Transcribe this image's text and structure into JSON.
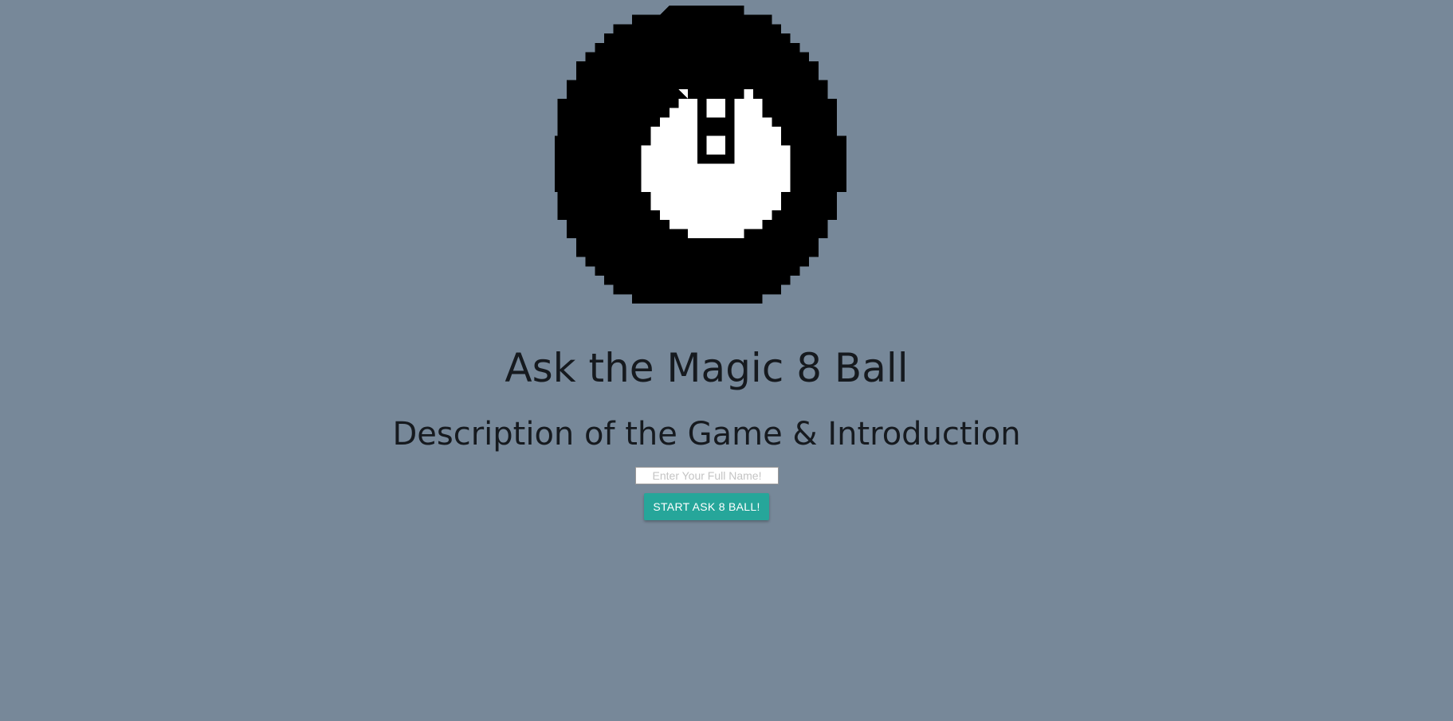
{
  "page": {
    "background_color": "#778899",
    "text_color": "#161a1f"
  },
  "logo": {
    "icon": "magic-8-ball-pixel-icon"
  },
  "header": {
    "title": "Ask the Magic 8 Ball",
    "subtitle": "Description of the Game & Introduction"
  },
  "form": {
    "name_placeholder": "Enter Your Full Name!",
    "name_value": "",
    "start_label": "START ASK 8 BALL!",
    "start_color": "#26a69a"
  }
}
